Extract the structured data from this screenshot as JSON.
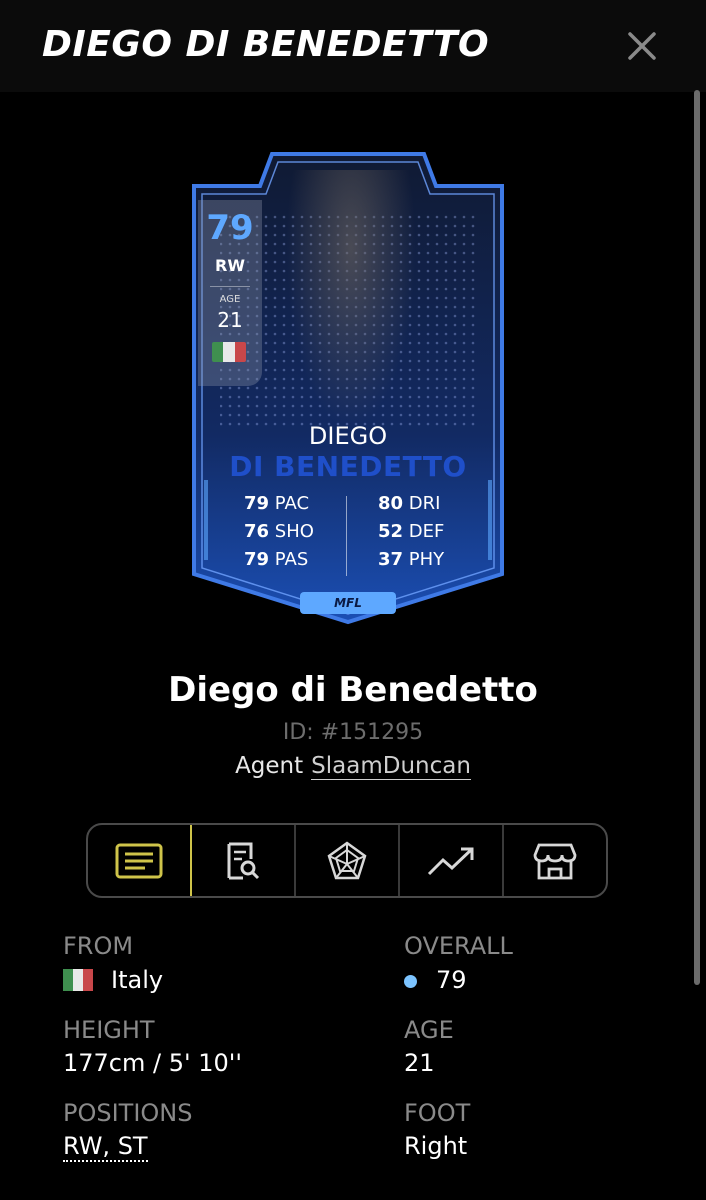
{
  "header": {
    "title": "DIEGO DI BENEDETTO"
  },
  "card": {
    "rating": "79",
    "position": "RW",
    "age_label": "AGE",
    "age": "21",
    "first_name": "DIEGO",
    "last_name": "DI BENEDETTO",
    "stats_left": [
      {
        "value": "79",
        "label": "PAC"
      },
      {
        "value": "76",
        "label": "SHO"
      },
      {
        "value": "79",
        "label": "PAS"
      }
    ],
    "stats_right": [
      {
        "value": "80",
        "label": "DRI"
      },
      {
        "value": "52",
        "label": "DEF"
      },
      {
        "value": "37",
        "label": "PHY"
      }
    ],
    "logo_text": "MFL"
  },
  "player": {
    "name": "Diego di Benedetto",
    "id": "ID: #151295",
    "agent_label": "Agent",
    "agent_name": "SlaamDuncan"
  },
  "tabs": [
    {
      "icon": "list-icon",
      "active": true
    },
    {
      "icon": "document-search-icon",
      "active": false
    },
    {
      "icon": "radar-chart-icon",
      "active": false
    },
    {
      "icon": "trend-up-icon",
      "active": false
    },
    {
      "icon": "store-icon",
      "active": false
    }
  ],
  "info": {
    "from_label": "FROM",
    "from_value": "Italy",
    "overall_label": "OVERALL",
    "overall_value": "79",
    "height_label": "HEIGHT",
    "height_value": "177cm / 5' 10''",
    "age_label": "AGE",
    "age_value": "21",
    "positions_label": "POSITIONS",
    "positions_value": "RW, ST",
    "foot_label": "FOOT",
    "foot_value": "Right"
  },
  "colors": {
    "accent_blue": "#5ea8ff",
    "active_tab": "#cfc44a",
    "overall_dot": "#7cc4ff",
    "flag_green": "#3f8f4f",
    "flag_white": "#e9e9e9",
    "flag_red": "#c8474a"
  }
}
